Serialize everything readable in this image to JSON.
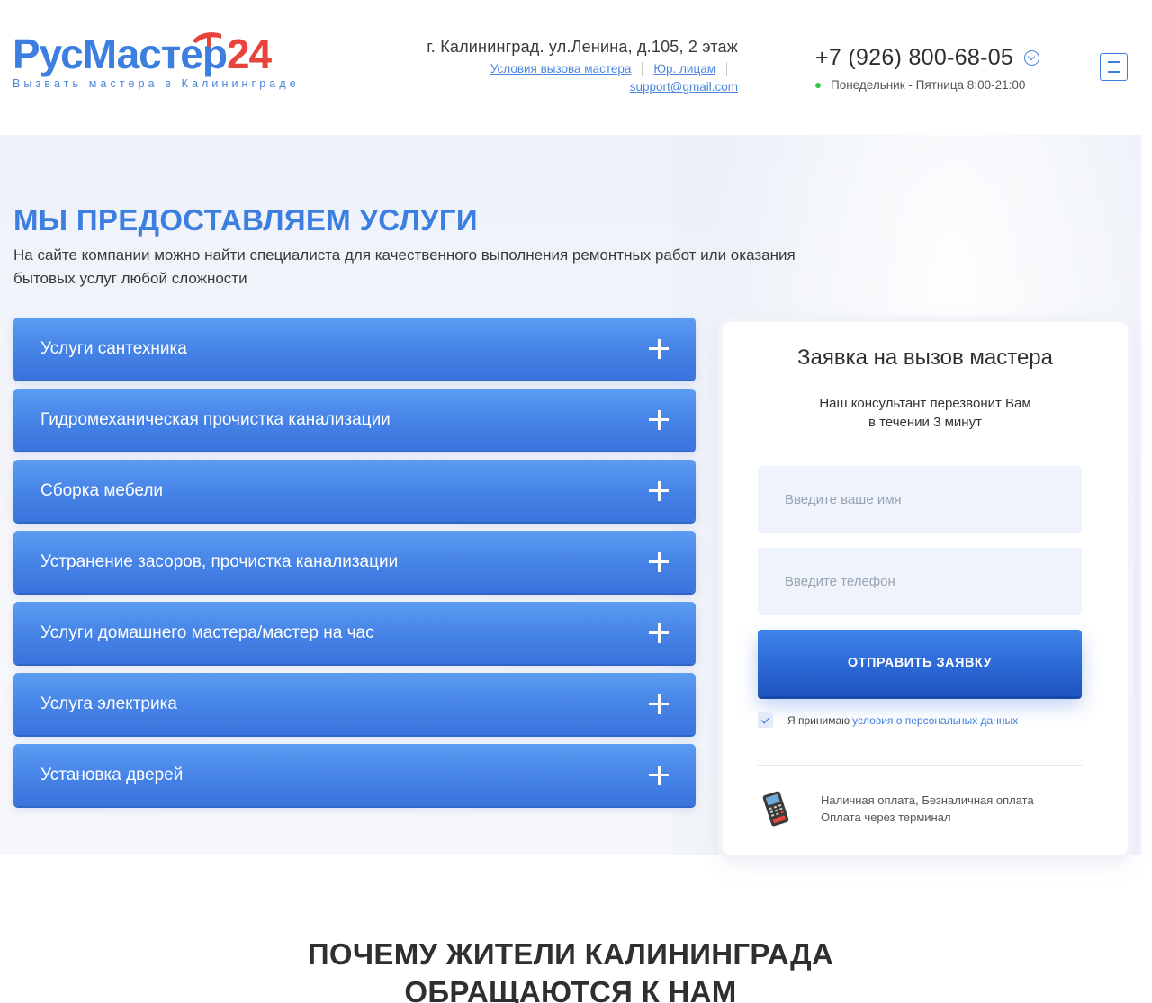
{
  "header": {
    "logo": {
      "part1": "РусМас",
      "part2": "тер",
      "part3": "24",
      "tagline": "Вызвать мастера в Калининграде"
    },
    "address": "г. Калининград. ул.Ленина, д.105, 2 этаж",
    "links": {
      "conditions": "Условия вызова мастера",
      "legal": "Юр. лицам",
      "email": "support@gmail.com"
    },
    "phone": "+7 (926) 800-68-05",
    "hours": "Понедельник - Пятница 8:00-21:00"
  },
  "hero": {
    "title": "МЫ ПРЕДОСТАВЛЯЕМ УСЛУГИ",
    "description": "На сайте компании можно найти специалиста для качественного выполнения ремонтных работ или оказания бытовых услуг любой сложности",
    "services": [
      {
        "label": "Услуги сантехника"
      },
      {
        "label": "Гидромеханическая прочистка канализации"
      },
      {
        "label": "Сборка мебели"
      },
      {
        "label": "Устранение засоров, прочистка канализации"
      },
      {
        "label": "Услуги домашнего мастера/мастер на час"
      },
      {
        "label": "Услуга электрика"
      },
      {
        "label": "Установка дверей"
      }
    ]
  },
  "form": {
    "title": "Заявка на вызов мастера",
    "subtitle_line1": "Наш консультант перезвонит Вам",
    "subtitle_line2": "в течении 3 минут",
    "name_placeholder": "Введите ваше имя",
    "phone_placeholder": "Введите телефон",
    "submit_label": "ОТПРАВИТЬ ЗАЯВКУ",
    "consent_text": "Я принимаю",
    "consent_link": "условия о персональных данных",
    "consent_checked": true,
    "payment_line1": "Наличная оплата, Безналичная оплата",
    "payment_line2": "Оплата через терминал"
  },
  "why": {
    "line1": "ПОЧЕМУ ЖИТЕЛИ КАЛИНИНГРАДА",
    "line2": "ОБРАЩАЮТСЯ К НАМ"
  },
  "colors": {
    "brand_blue": "#3d7fe0",
    "brand_red": "#e8443c",
    "button_blue": "#2a66d3",
    "status_green": "#2ec64b"
  },
  "icons": [
    "hammer-icon",
    "chevron-down-icon",
    "menu-icon",
    "plus-icon",
    "check-icon",
    "payment-terminal-icon"
  ]
}
